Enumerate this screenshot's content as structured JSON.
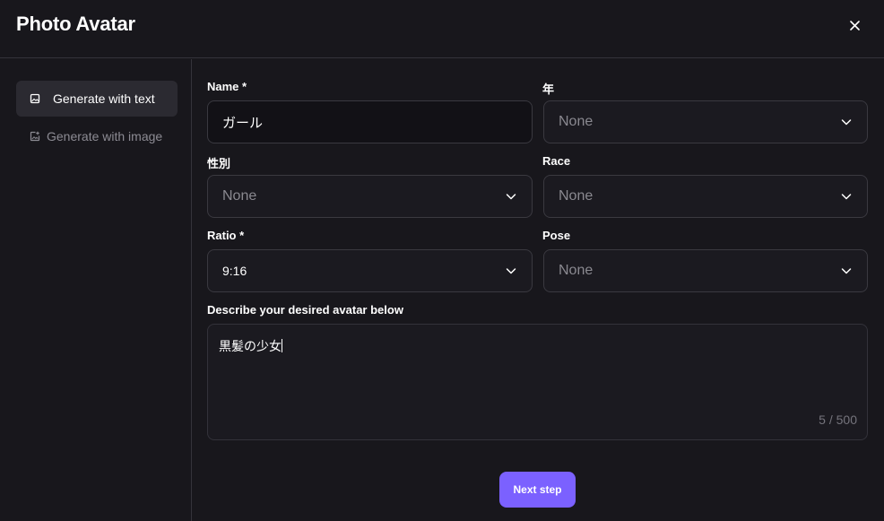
{
  "header": {
    "title": "Photo Avatar"
  },
  "sidebar": {
    "items": [
      {
        "label": "Generate with text",
        "icon": "image-icon"
      },
      {
        "label": "Generate with image",
        "icon": "image-upload-icon"
      }
    ]
  },
  "form": {
    "name": {
      "label": "Name *",
      "value": "ガール"
    },
    "age": {
      "label": "年",
      "value": "None"
    },
    "gender": {
      "label": "性別",
      "value": "None"
    },
    "race": {
      "label": "Race",
      "value": "None"
    },
    "ratio": {
      "label": "Ratio *",
      "value": "9:16"
    },
    "pose": {
      "label": "Pose",
      "value": "None"
    },
    "description": {
      "label": "Describe your desired avatar below",
      "value": "黒髪の少女",
      "counter": "5 / 500"
    }
  },
  "actions": {
    "next_label": "Next step"
  },
  "colors": {
    "accent": "#7b61ff",
    "background": "#18171c"
  }
}
